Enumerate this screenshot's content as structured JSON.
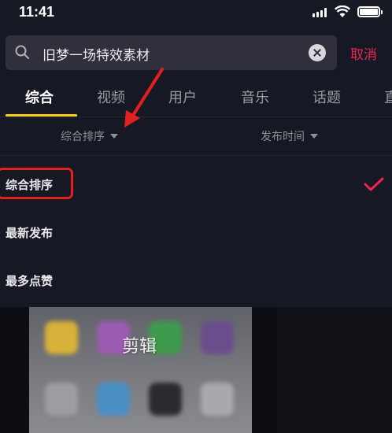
{
  "status_bar": {
    "time": "11:41"
  },
  "search": {
    "query": "旧梦一场特效素材",
    "cancel_label": "取消"
  },
  "tabs": [
    {
      "label": "综合",
      "active": true
    },
    {
      "label": "视频",
      "active": false
    },
    {
      "label": "用户",
      "active": false
    },
    {
      "label": "音乐",
      "active": false
    },
    {
      "label": "话题",
      "active": false
    },
    {
      "label": "直",
      "active": false
    }
  ],
  "sort_bar": {
    "sort_label": "综合排序",
    "time_label": "发布时间"
  },
  "sort_menu": {
    "options": [
      {
        "label": "综合排序",
        "selected": true
      },
      {
        "label": "最新发布",
        "selected": false
      },
      {
        "label": "最多点赞",
        "selected": false
      }
    ]
  },
  "result": {
    "thumbnail_title": "剪辑"
  },
  "colors": {
    "background": "#161823",
    "accent_red": "#f0254e",
    "tab_underline": "#face15",
    "annotation_red": "#e3201f"
  },
  "icons": [
    "search-icon",
    "clear-icon",
    "check-icon",
    "caret-down-icon",
    "signal-icon",
    "wifi-icon",
    "battery-icon"
  ]
}
